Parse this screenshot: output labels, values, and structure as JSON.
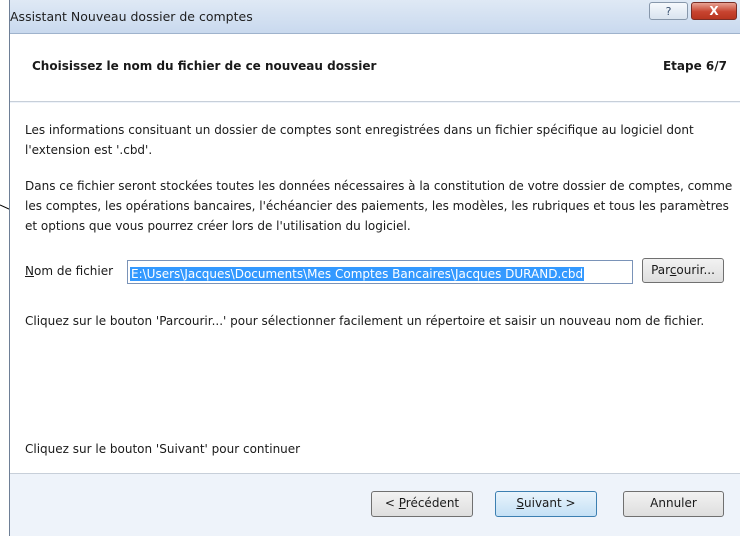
{
  "window": {
    "title": "Assistant Nouveau dossier de comptes",
    "help_label": "?",
    "close_label": "X"
  },
  "header": {
    "title": "Choisissez le nom du fichier de ce nouveau dossier",
    "step": "Etape 6/7"
  },
  "content": {
    "paragraph1": "Les informations consituant un dossier de comptes sont enregistrées dans un fichier spécifique au logiciel dont l'extension est '.cbd'.",
    "paragraph2": "Dans ce fichier seront stockées toutes les données nécessaires à la constitution de votre dossier de comptes, comme les comptes, les opérations bancaires, l'échéancier des paiements, les modèles, les rubriques et tous les paramètres et options que vous pourrez créer lors de l'utilisation du logiciel.",
    "filename_label_underlined": "N",
    "filename_label_rest": "om de fichier",
    "filename_value": "E:\\Users\\Jacques\\Documents\\Mes Comptes Bancaires\\Jacques DURAND.cbd",
    "browse_label_before": "Par",
    "browse_label_underlined": "c",
    "browse_label_after": "ourir...",
    "paragraph3": "Cliquez sur le bouton 'Parcourir...' pour sélectionner facilement un répertoire et saisir un nouveau nom de fichier.",
    "paragraph4": "Cliquez sur le bouton 'Suivant' pour continuer"
  },
  "footer": {
    "prev_before": "< ",
    "prev_underlined": "P",
    "prev_after": "récédent",
    "next_underlined": "S",
    "next_after": "uivant >",
    "cancel_label": "Annuler"
  }
}
